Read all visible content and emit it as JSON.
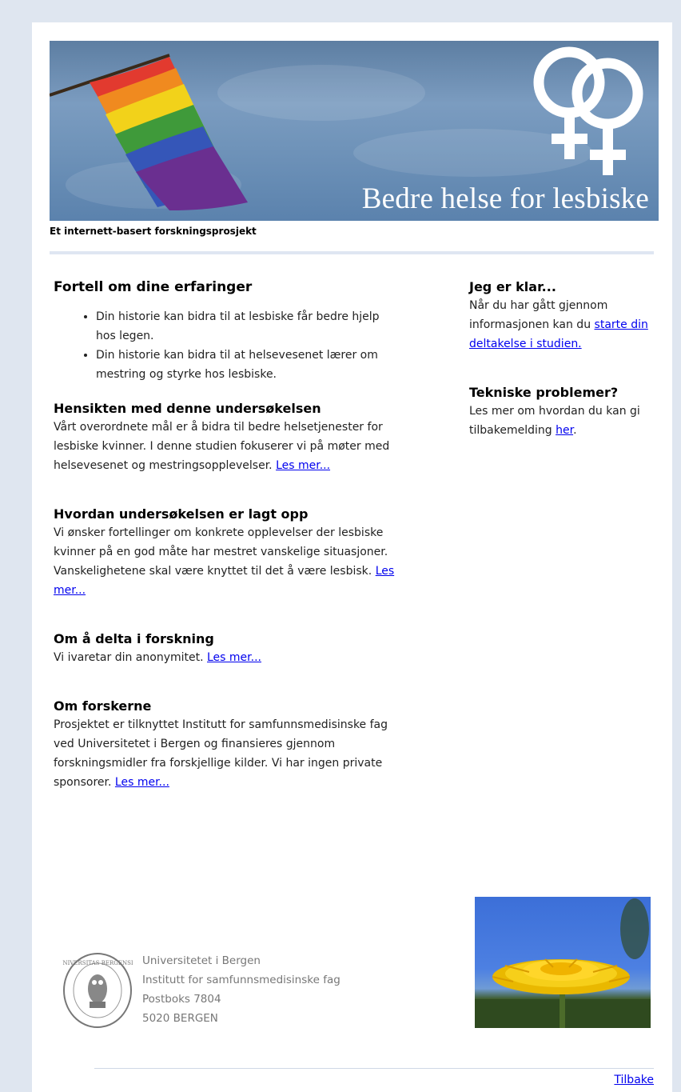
{
  "header": {
    "banner_title": "Bedre helse for lesbiske",
    "subtitle": "Et internett-basert forskningsprosjekt"
  },
  "main": {
    "intro": {
      "heading": "Fortell om dine erfaringer",
      "bullets": [
        "Din historie kan bidra til at lesbiske får bedre hjelp hos legen.",
        "Din historie kan bidra til at helsevesenet lærer om mestring og styrke hos lesbiske."
      ]
    },
    "purpose": {
      "heading": "Hensikten med denne undersøkelsen",
      "text": "Vårt overordnete mål er å bidra til bedre helsetjenester for lesbiske kvinner.   I denne studien fokuserer vi på møter med helsevesenet og mestringsopplevelser.",
      "link": "Les mer..."
    },
    "structure": {
      "heading": "Hvordan undersøkelsen er lagt opp",
      "text": "Vi ønsker fortellinger om konkrete opplevelser der lesbiske kvinner på en god måte har mestret vanskelige situasjoner. Vanskelighetene skal være knyttet til det å være lesbisk.",
      "link": "Les mer..."
    },
    "participate": {
      "heading": "Om å delta i forskning",
      "text": "Vi ivaretar din anonymitet.",
      "link": "Les mer..."
    },
    "researchers": {
      "heading": "Om forskerne",
      "text": "Prosjektet er tilknyttet Institutt for samfunnsmedisinske fag ved Universitetet i Bergen og finansieres gjennom forskningsmidler fra forskjellige kilder. Vi har ingen private sponsorer.",
      "link": "Les mer..."
    }
  },
  "sidebar": {
    "ready": {
      "heading": "Jeg er klar...",
      "text": "Når du har gått gjennom informasjonen kan du",
      "link": "starte din deltakelse i studien."
    },
    "technical": {
      "heading": "Tekniske problemer?",
      "text": "Les mer om hvordan du kan gi tilbakemelding",
      "link": "her",
      "suffix": "."
    }
  },
  "footer": {
    "address_lines": [
      "Universitetet i Bergen",
      "Institutt for samfunnsmedisinske fag",
      "Postboks 7804",
      "5020 BERGEN"
    ],
    "seal_text": "UNIVERSITAS BERGENSIS",
    "back_link": "Tilbake"
  },
  "colors": {
    "page_background": "#dfe6f0",
    "link": "#0000ee",
    "divider": "#dfe6f2"
  },
  "icons": [
    "rainbow-flag-icon",
    "venus-symbol-icon",
    "university-seal-icon",
    "dandelion-photo"
  ]
}
